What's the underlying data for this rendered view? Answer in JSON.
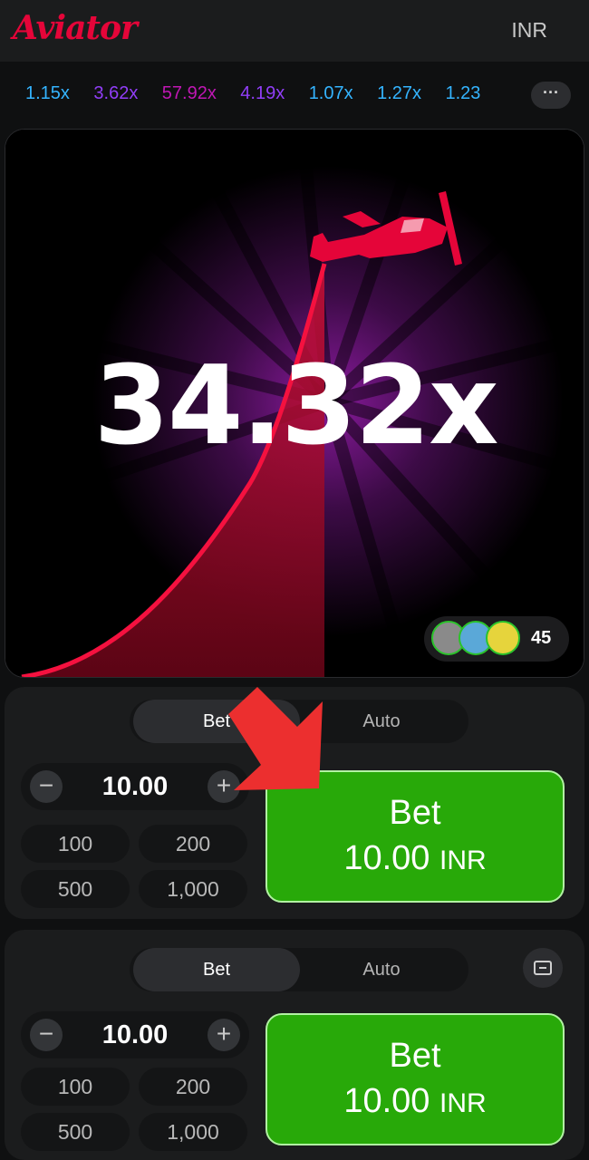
{
  "header": {
    "logo": "Aviator",
    "currency": "INR"
  },
  "history": {
    "items": [
      {
        "value": "1.15x",
        "color": "#34b4ff"
      },
      {
        "value": "3.62x",
        "color": "#913ef8"
      },
      {
        "value": "57.92x",
        "color": "#c017b4"
      },
      {
        "value": "4.19x",
        "color": "#913ef8"
      },
      {
        "value": "1.07x",
        "color": "#34b4ff"
      },
      {
        "value": "1.27x",
        "color": "#34b4ff"
      },
      {
        "value": "1.23",
        "color": "#34b4ff"
      }
    ],
    "more_label": "···"
  },
  "game": {
    "multiplier": "34.32x",
    "players_count": "45"
  },
  "panels": [
    {
      "tabs": {
        "bet": "Bet",
        "auto": "Auto"
      },
      "stake": "10.00",
      "minus": "−",
      "plus": "+",
      "quick": [
        "100",
        "200",
        "500",
        "1,000"
      ],
      "bet_button": {
        "title": "Bet",
        "amount": "10.00",
        "currency": "INR"
      }
    },
    {
      "tabs": {
        "bet": "Bet",
        "auto": "Auto"
      },
      "stake": "10.00",
      "minus": "−",
      "plus": "+",
      "quick": [
        "100",
        "200",
        "500",
        "1,000"
      ],
      "bet_button": {
        "title": "Bet",
        "amount": "10.00",
        "currency": "INR"
      }
    }
  ],
  "colors": {
    "accent_red": "#e50539",
    "bet_green": "#28a909"
  }
}
